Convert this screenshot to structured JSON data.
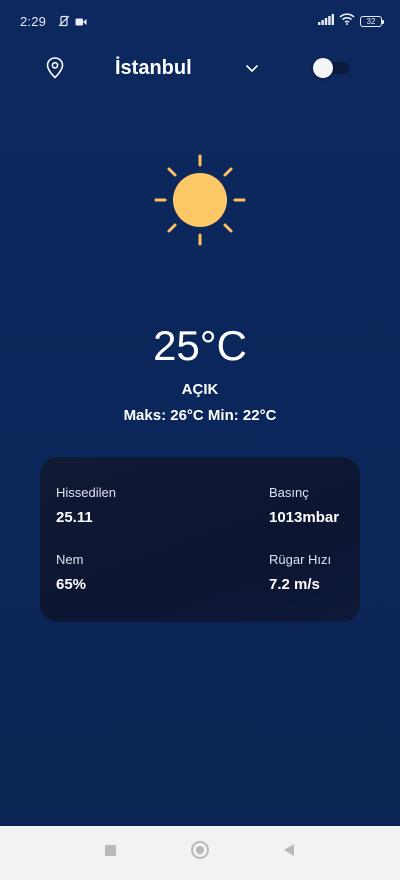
{
  "status_bar": {
    "time": "2:29",
    "left_icons": [
      "mute-icon",
      "video-camera-icon"
    ],
    "right_icons": [
      "signal-icon",
      "wifi-icon",
      "battery-icon"
    ],
    "battery_level": "32"
  },
  "header": {
    "location_icon": "location-pin-icon",
    "city": "İstanbul",
    "dropdown_icon": "chevron-down-icon",
    "theme_toggle_on": false
  },
  "weather": {
    "icon": "sun-icon",
    "temperature": "25°C",
    "condition": "AÇIK",
    "minmax": "Maks: 26°C Min: 22°C"
  },
  "details": {
    "feels_like_label": "Hissedilen",
    "feels_like_value": "25.11",
    "pressure_label": "Basınç",
    "pressure_value": "1013mbar",
    "humidity_label": "Nem",
    "humidity_value": "65%",
    "wind_label": "Rügar Hızı",
    "wind_value": "7.2 m/s"
  },
  "nav_bar": {
    "recents_icon": "square-icon",
    "home_icon": "circle-icon",
    "back_icon": "triangle-back-icon"
  },
  "colors": {
    "background": "#0b2559",
    "card": "#0e1836",
    "sun": "#fcc865",
    "sun_rays": "#f7c35a",
    "nav_bar": "#f2f2f2"
  }
}
